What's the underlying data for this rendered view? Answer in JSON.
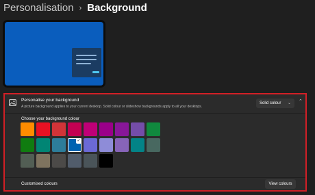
{
  "breadcrumb": {
    "parent": "Personalisation",
    "separator": "›",
    "current": "Background"
  },
  "personalise": {
    "title": "Personalise your background",
    "description": "A picture background applies to your current desktop. Solid colour or slideshow backgrounds apply to all your desktops.",
    "dropdown_value": "Solid colour",
    "dropdown_chevron": "⌄",
    "collapse_chevron": "⌃"
  },
  "colour_grid": {
    "label": "Choose your background colour",
    "selected": "#0063b1",
    "rows": [
      [
        "#ff8c00",
        "#e81123",
        "#d13438",
        "#c30052",
        "#bf0077",
        "#9a0089",
        "#881798",
        "#744da9",
        "#10893e"
      ],
      [
        "#107c10",
        "#018574",
        "#2d7d9a",
        "#0063b1",
        "#6b69d6",
        "#8e8cd8",
        "#8764b8",
        "#038387",
        "#486860"
      ],
      [
        "#525e54",
        "#7e735f",
        "#4c4a48",
        "#515c6b",
        "#4a5459",
        "#000000"
      ]
    ]
  },
  "custom": {
    "label": "Customised colours",
    "button_label": "View colours"
  },
  "icons": {
    "header": "picture-icon",
    "check": "✓"
  }
}
